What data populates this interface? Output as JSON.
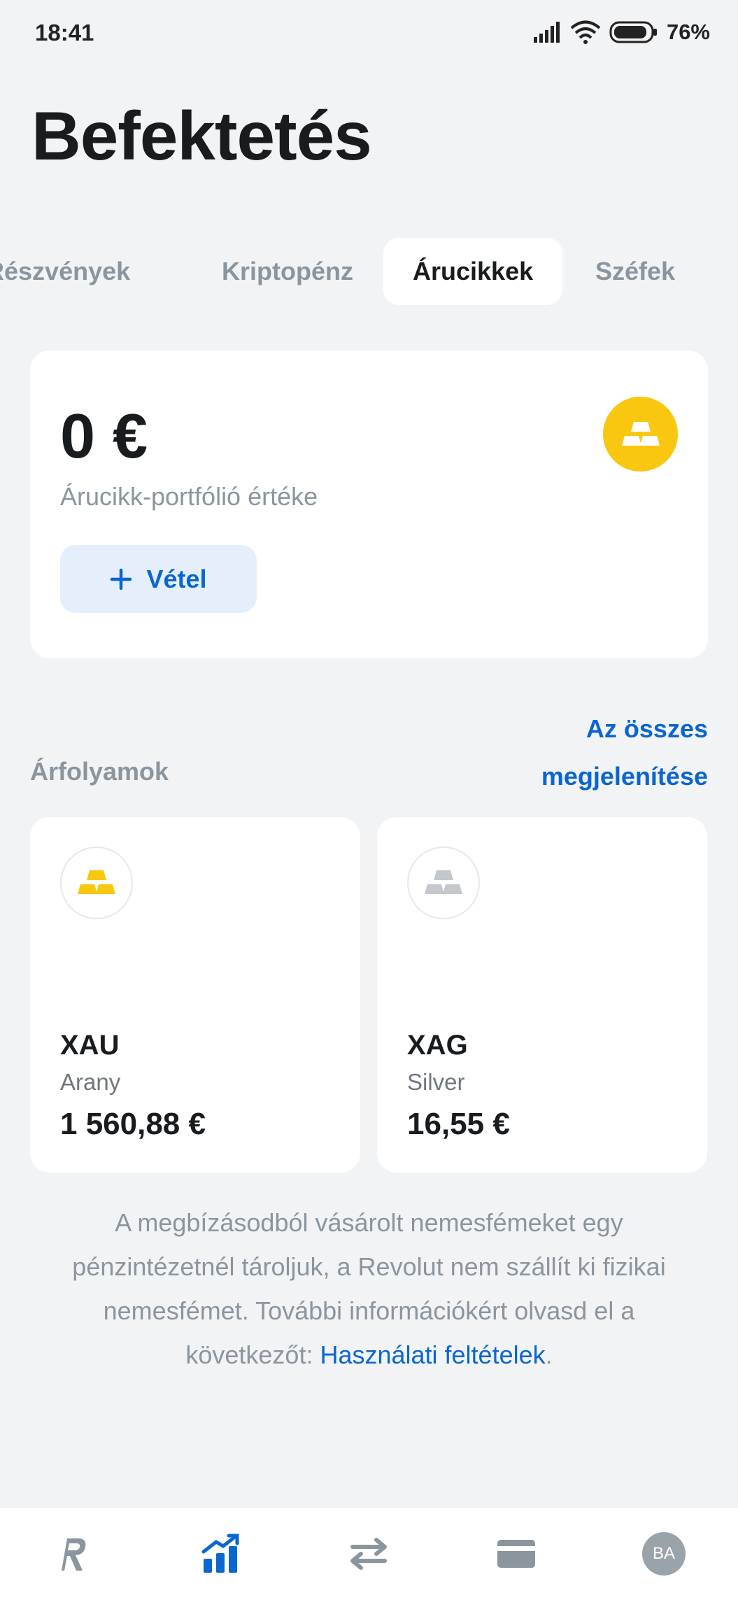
{
  "status": {
    "time": "18:41",
    "battery": "76%"
  },
  "title": "Befektetés",
  "tabs": [
    {
      "label": "Részvények",
      "active": false
    },
    {
      "label": "Kriptopénz",
      "active": false
    },
    {
      "label": "Árucikkek",
      "active": true
    },
    {
      "label": "Széfek",
      "active": false
    }
  ],
  "portfolio": {
    "amount": "0 €",
    "label": "Árucikk-portfólió értéke",
    "buy_label": "Vétel",
    "icon_color": "#f9c70f"
  },
  "rates": {
    "title": "Árfolyamok",
    "see_all_line1": "Az összes",
    "see_all_line2": "megjelenítése"
  },
  "assets": [
    {
      "symbol": "XAU",
      "name": "Arany",
      "price": "1 560,88 €",
      "icon": "gold-bars-icon",
      "color": "#f9c70f"
    },
    {
      "symbol": "XAG",
      "name": "Silver",
      "price": "16,55 €",
      "icon": "silver-bars-icon",
      "color": "#c4c8cc"
    }
  ],
  "disclaimer": {
    "text": "A megbízásodból vásárolt nemesfémeket egy pénzintézetnél tároljuk, a Revolut nem szállít ki fizikai nemesfémet. További információkért olvasd el a következőt: ",
    "link": "Használati feltételek",
    "end": "."
  },
  "nav": {
    "items": [
      "home-icon",
      "invest-icon",
      "transfer-icon",
      "card-icon",
      "profile-avatar"
    ],
    "active": "invest-icon",
    "avatar_initials": "BA",
    "active_color": "#0a66d0",
    "inactive_color": "#8b959e"
  },
  "colors": {
    "accent": "#0a66d0",
    "background": "#f2f3f5",
    "gold": "#f9c70f"
  }
}
